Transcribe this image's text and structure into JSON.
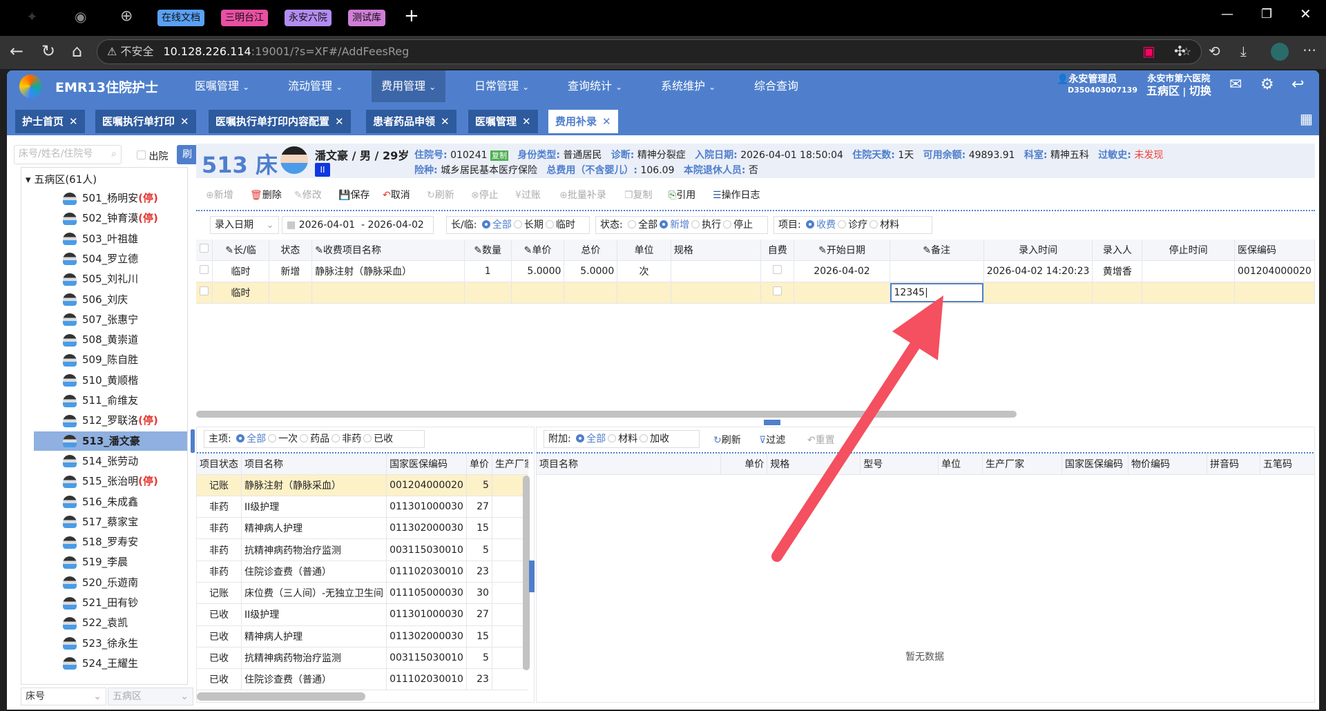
{
  "browser": {
    "tabs": [
      {
        "label": "在线文档",
        "color": "#5aa0f5"
      },
      {
        "label": "三明台江",
        "color": "#ea4fa3"
      },
      {
        "label": "永安六院",
        "color": "#b48cf2"
      },
      {
        "label": "测试库",
        "color": "#d07ed8"
      }
    ],
    "security": "不安全",
    "url_host": "10.128.226.114",
    "url_rest": ":19001/?s=XF#/AddFeesReg"
  },
  "app": {
    "title": "EMR13住院护士",
    "menus": [
      "医嘱管理",
      "流动管理",
      "费用管理",
      "日常管理",
      "查询统计",
      "系统维护",
      "综合查询"
    ],
    "active_menu": "费用管理",
    "user_name": "永安管理员",
    "user_id": "D350403007139",
    "hospital": "永安市第六医院",
    "ward": "五病区",
    "switch": "切换",
    "accent": "#4f7fcc"
  },
  "page_tabs": [
    "护士首页",
    "医嘱执行单打印",
    "医嘱执行单打印内容配置",
    "患者药品申领",
    "医嘱管理",
    "费用补录"
  ],
  "sidebar": {
    "search_placeholder": "床号/姓名/住院号",
    "discharged_label": "出院",
    "refresh": "刷",
    "root": "五病区(61人)",
    "stop_tag": "(停)",
    "patients": [
      {
        "n": "501_杨明安",
        "s": 1
      },
      {
        "n": "502_钟育漠",
        "s": 1
      },
      {
        "n": "503_叶祖雄"
      },
      {
        "n": "504_罗立德"
      },
      {
        "n": "505_刘礼川"
      },
      {
        "n": "506_刘庆"
      },
      {
        "n": "507_张惠宁"
      },
      {
        "n": "508_黄崇道"
      },
      {
        "n": "509_陈自胜"
      },
      {
        "n": "510_黄顺楷"
      },
      {
        "n": "511_俞维友"
      },
      {
        "n": "512_罗联洛",
        "s": 1
      },
      {
        "n": "513_潘文豪",
        "sel": 1
      },
      {
        "n": "514_张劳动"
      },
      {
        "n": "515_张治明",
        "s": 1
      },
      {
        "n": "516_朱成鑫"
      },
      {
        "n": "517_蔡家宝"
      },
      {
        "n": "518_罗寿安"
      },
      {
        "n": "519_李晨"
      },
      {
        "n": "520_乐遊南"
      },
      {
        "n": "521_田有钞"
      },
      {
        "n": "522_袁凯"
      },
      {
        "n": "523_徐永生"
      },
      {
        "n": "524_王耀生"
      }
    ],
    "sort_select": "床号",
    "ward_select": "五病区"
  },
  "patient": {
    "bed": "513 床",
    "name_line": "潘文豪 / 男 / 29岁",
    "level": "II",
    "inpatient_no_label": "住院号:",
    "inpatient_no": "010241",
    "copy": "复制",
    "id_type_label": "身份类型:",
    "id_type": "普通居民",
    "diag_label": "诊断:",
    "diag": "精神分裂症",
    "admit_label": "入院日期:",
    "admit": "2026-04-01 18:50:04",
    "days_label": "住院天数:",
    "days": "1天",
    "balance_label": "可用余额:",
    "balance": "49893.91",
    "dept_label": "科室:",
    "dept": "精神五科",
    "allergy_label": "过敏史:",
    "allergy": "未发现",
    "ins_label": "险种:",
    "ins": "城乡居民基本医疗保险",
    "total_label": "总费用（不含婴儿）:",
    "total": "106.09",
    "retired_label": "本院退休人员:",
    "retired": "否"
  },
  "toolbar": [
    {
      "l": "新增",
      "i": "⊕",
      "d": 1,
      "n": "add"
    },
    {
      "l": "删除",
      "i": "🗑",
      "c": "#e53935",
      "n": "delete"
    },
    {
      "l": "修改",
      "i": "✎",
      "d": 1,
      "n": "edit"
    },
    {
      "l": "保存",
      "i": "💾",
      "c": "#2e5a9e",
      "n": "save"
    },
    {
      "l": "取消",
      "i": "↶",
      "c": "#e53935",
      "n": "cancel"
    },
    {
      "l": "刷新",
      "i": "↻",
      "d": 1,
      "n": "refresh"
    },
    {
      "l": "停止",
      "i": "⊗",
      "d": 1,
      "n": "stop"
    },
    {
      "l": "过账",
      "i": "¥",
      "d": 1,
      "n": "post"
    },
    {
      "l": "批量补录",
      "i": "⊕",
      "d": 1,
      "n": "batch"
    },
    {
      "l": "复制",
      "i": "❐",
      "d": 1,
      "n": "copy"
    },
    {
      "l": "引用",
      "i": "⎘",
      "c": "#2e7d32",
      "n": "quote"
    },
    {
      "l": "操作日志",
      "i": "☰",
      "c": "#2e5a9e",
      "n": "log"
    }
  ],
  "filters": {
    "date_type": "录入日期",
    "date_from": "2026-04-01",
    "date_to": "2026-04-02",
    "long_label": "长/临:",
    "long_opts": [
      "全部",
      "长期",
      "临时"
    ],
    "long_sel": 0,
    "state_label": "状态:",
    "state_opts": [
      "全部",
      "新增",
      "执行",
      "停止"
    ],
    "state_sel": 1,
    "item_label": "项目:",
    "item_opts": [
      "收费",
      "诊疗",
      "材料"
    ],
    "item_sel": 0
  },
  "grid": {
    "headers": [
      "",
      "✎长/临",
      "状态",
      "✎收费项目名称",
      "✎数量",
      "✎单价",
      "总价",
      "单位",
      "规格",
      "自费",
      "✎开始日期",
      "✎备注",
      "录入时间",
      "录入人",
      "停止时间",
      "医保编码"
    ],
    "rows": [
      [
        "",
        "临时",
        "新增",
        "静脉注射（静脉采血）",
        "1",
        "5.0000",
        "5.0000",
        "次",
        "",
        "",
        "2026-04-02",
        "",
        "2026-04-02 14:20:23",
        "黄增香",
        "",
        "001204000020"
      ],
      [
        "",
        "临时",
        "",
        "",
        "",
        "",
        "",
        "",
        "",
        "",
        "",
        "12345",
        "",
        "",
        "",
        ""
      ]
    ]
  },
  "main_filter": {
    "label": "主项:",
    "opts": [
      "全部",
      "一次",
      "药品",
      "非药",
      "已收"
    ],
    "sel": 0
  },
  "main_items": {
    "headers": [
      "项目状态",
      "项目名称",
      "国家医保编码",
      "单价",
      "生产厂家"
    ],
    "rows": [
      [
        "记账",
        "静脉注射（静脉采血）",
        "001204000020",
        "5"
      ],
      [
        "非药",
        "II级护理",
        "011301000030",
        "27"
      ],
      [
        "非药",
        "精神病人护理",
        "011302000030",
        "15"
      ],
      [
        "非药",
        "抗精神病药物治疗监测",
        "003115030010",
        "5"
      ],
      [
        "非药",
        "住院诊查费（普通）",
        "011102030010",
        "23"
      ],
      [
        "记账",
        "床位费（三人间）-无独立卫生间",
        "011105000030",
        "30"
      ],
      [
        "已收",
        "II级护理",
        "011301000030",
        "27"
      ],
      [
        "已收",
        "精神病人护理",
        "011302000030",
        "15"
      ],
      [
        "已收",
        "抗精神病药物治疗监测",
        "003115030010",
        "5"
      ],
      [
        "已收",
        "住院诊查费（普通）",
        "011102030010",
        "23"
      ]
    ]
  },
  "extra_filter": {
    "label": "附加:",
    "opts": [
      "全部",
      "材料",
      "加收"
    ],
    "sel": 0,
    "refresh": "刷新",
    "filter": "过滤",
    "reset": "重置"
  },
  "extra_items": {
    "headers": [
      "项目名称",
      "单价",
      "规格",
      "型号",
      "单位",
      "生产厂家",
      "国家医保编码",
      "物价编码",
      "拼音码",
      "五笔码"
    ],
    "empty": "暂无数据"
  },
  "annotation": {
    "arrow_color": "#f4505f"
  }
}
